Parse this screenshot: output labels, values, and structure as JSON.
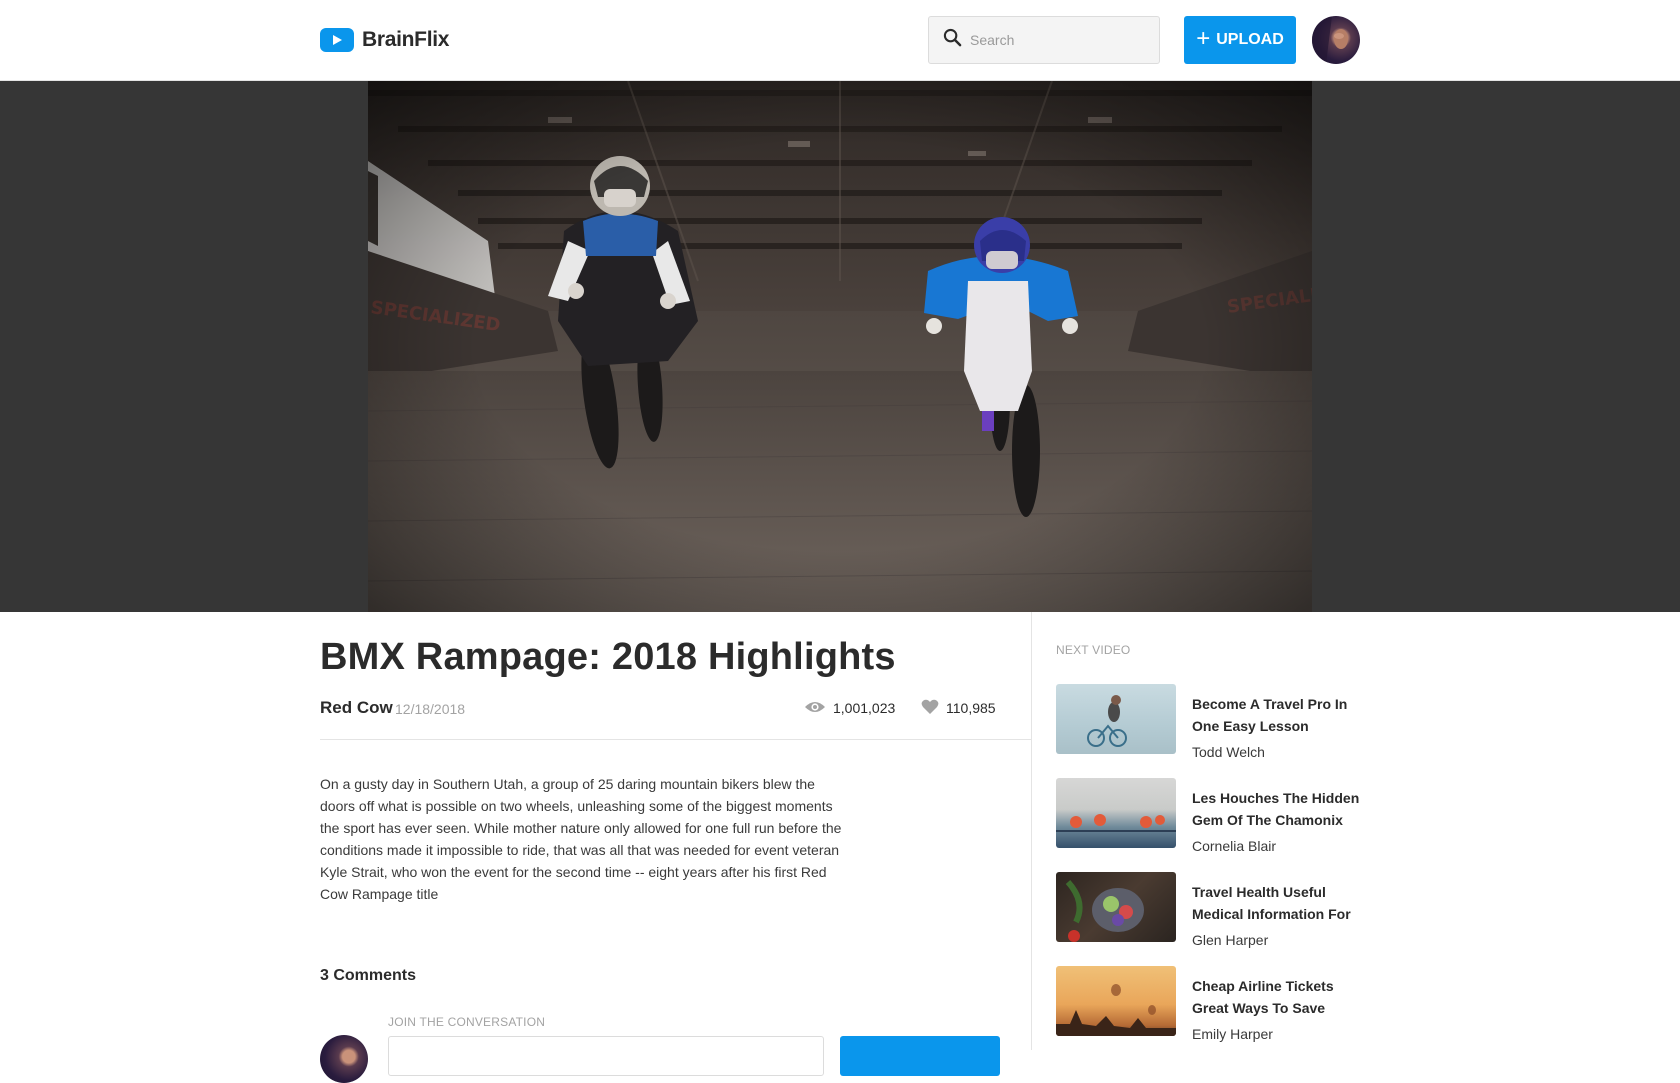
{
  "app": {
    "name": "BrainFlix"
  },
  "header": {
    "search_placeholder": "Search",
    "upload_label": "UPLOAD"
  },
  "video": {
    "title": "BMX Rampage: 2018 Highlights",
    "channel": "Red Cow",
    "date": "12/18/2018",
    "views": "1,001,023",
    "likes": "110,985",
    "description": "On a gusty day in Southern Utah, a group of 25 daring mountain bikers blew the doors off what is possible on two wheels, unleashing some of the biggest moments the sport has ever seen. While mother nature only allowed for one full run before the conditions made it impossible to ride, that was all that was needed for event veteran Kyle Strait, who won the event for the second time -- eight years after his first Red Cow Rampage title"
  },
  "comments": {
    "count_label": "3 Comments",
    "join_label": "JOIN THE CONVERSATION"
  },
  "sidebar": {
    "label": "NEXT VIDEO",
    "items": [
      {
        "title": "Become A Travel Pro In One Easy Lesson",
        "author": "Todd Welch"
      },
      {
        "title": "Les Houches The Hidden Gem Of The Chamonix",
        "author": "Cornelia Blair"
      },
      {
        "title": "Travel Health Useful Medical Information For",
        "author": "Glen Harper"
      },
      {
        "title": "Cheap Airline Tickets Great Ways To Save",
        "author": "Emily Harper"
      }
    ]
  },
  "colors": {
    "accent": "#0a96ec",
    "text": "#2b2b2b",
    "muted": "#a3a3a3",
    "video_stage": "#363636"
  },
  "icons": [
    "play-logo-icon",
    "search-icon",
    "plus-icon",
    "eye-icon",
    "heart-icon"
  ]
}
